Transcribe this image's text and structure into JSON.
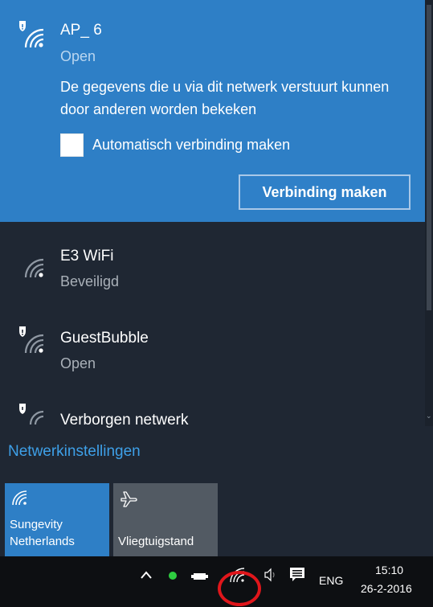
{
  "selected_network": {
    "name": "AP_ 6",
    "status": "Open",
    "warning": "De gegevens die u via dit netwerk verstuurt kunnen door anderen worden bekeken",
    "auto_connect_label": "Automatisch verbinding maken",
    "auto_connect_checked": false,
    "connect_label": "Verbinding maken"
  },
  "networks": [
    {
      "name": "E3 WiFi",
      "status": "Beveiligd"
    },
    {
      "name": "GuestBubble",
      "status": "Open"
    },
    {
      "name": "Verborgen netwerk"
    }
  ],
  "settings_link": "Netwerkinstellingen",
  "tiles": [
    {
      "label": "Sungevity Netherlands",
      "line1": "Sungevity",
      "line2": "Netherlands",
      "icon": "wifi-icon",
      "active": true
    },
    {
      "label": "Vliegtuigstand",
      "icon": "airplane-icon",
      "active": false
    }
  ],
  "taskbar": {
    "language": "ENG",
    "time": "15:10",
    "date": "26-2-2016"
  },
  "colors": {
    "accent": "#2e7fc6",
    "flyout_bg": "#1f2733",
    "link": "#3ea0e8",
    "highlight_circle": "#e0161b"
  }
}
